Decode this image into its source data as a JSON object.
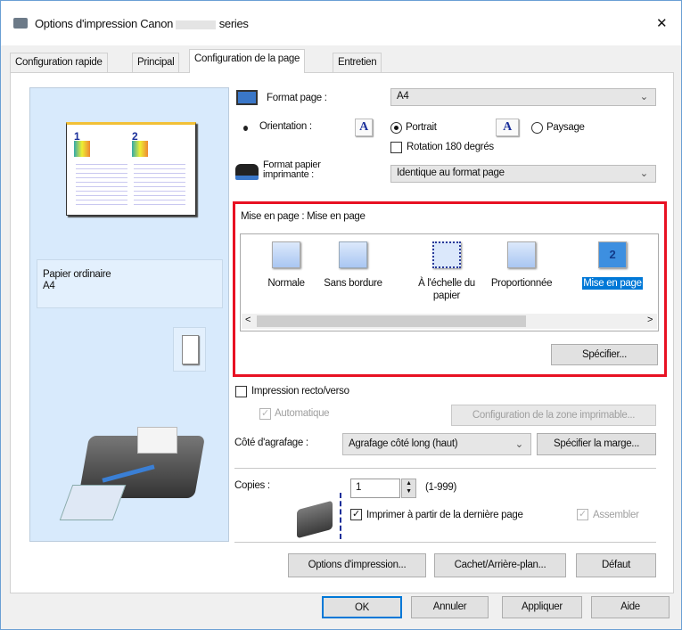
{
  "window": {
    "title": "Options d'impression Canon",
    "title_suffix": "series",
    "close": "✕"
  },
  "tabs": [
    {
      "label": "Configuration rapide"
    },
    {
      "label": "Principal"
    },
    {
      "label": "Configuration de la page"
    },
    {
      "label": "Entretien"
    }
  ],
  "preview": {
    "media_type": "Papier ordinaire",
    "paper_size": "A4",
    "page_numbers": [
      "1",
      "2"
    ]
  },
  "page_size": {
    "label": "Format page :",
    "value": "A4"
  },
  "orientation": {
    "label": "Orientation :",
    "portrait": "Portrait",
    "landscape": "Paysage",
    "selected": "Portrait",
    "rotate_label": "Rotation 180 degrés",
    "rotate_checked": false,
    "icon_glyph": "A"
  },
  "printer_paper": {
    "label_line1": "Format papier",
    "label_line2": "imprimante :",
    "value": "Identique au format page"
  },
  "layout": {
    "label": "Mise en page :",
    "current": "Mise en page",
    "items": [
      {
        "label": "Normale"
      },
      {
        "label": "Sans bordure"
      },
      {
        "label": "À l'échelle du papier"
      },
      {
        "label": "Proportionnée"
      },
      {
        "label": "Mise en page",
        "icon_text": "2",
        "selected": true
      }
    ],
    "specify": "Spécifier..."
  },
  "duplex": {
    "label": "Impression recto/verso",
    "checked": false,
    "auto_label": "Automatique",
    "auto_checked": true,
    "print_area": "Configuration de la zone imprimable..."
  },
  "stapling": {
    "label": "Côté d'agrafage :",
    "value": "Agrafage côté long (haut)",
    "margin": "Spécifier la marge..."
  },
  "copies": {
    "label": "Copies :",
    "value": "1",
    "range": "(1-999)",
    "reverse_label": "Imprimer à partir de la dernière page",
    "reverse_checked": true,
    "collate_label": "Assembler",
    "collate_checked": true
  },
  "actions": {
    "options": "Options d'impression...",
    "stamp": "Cachet/Arrière-plan...",
    "defaults": "Défaut"
  },
  "footer": {
    "ok": "OK",
    "cancel": "Annuler",
    "apply": "Appliquer",
    "help": "Aide"
  },
  "colors": {
    "highlight": "#e81123",
    "selection": "#0078d7",
    "preview_bg": "#d8eafc"
  }
}
